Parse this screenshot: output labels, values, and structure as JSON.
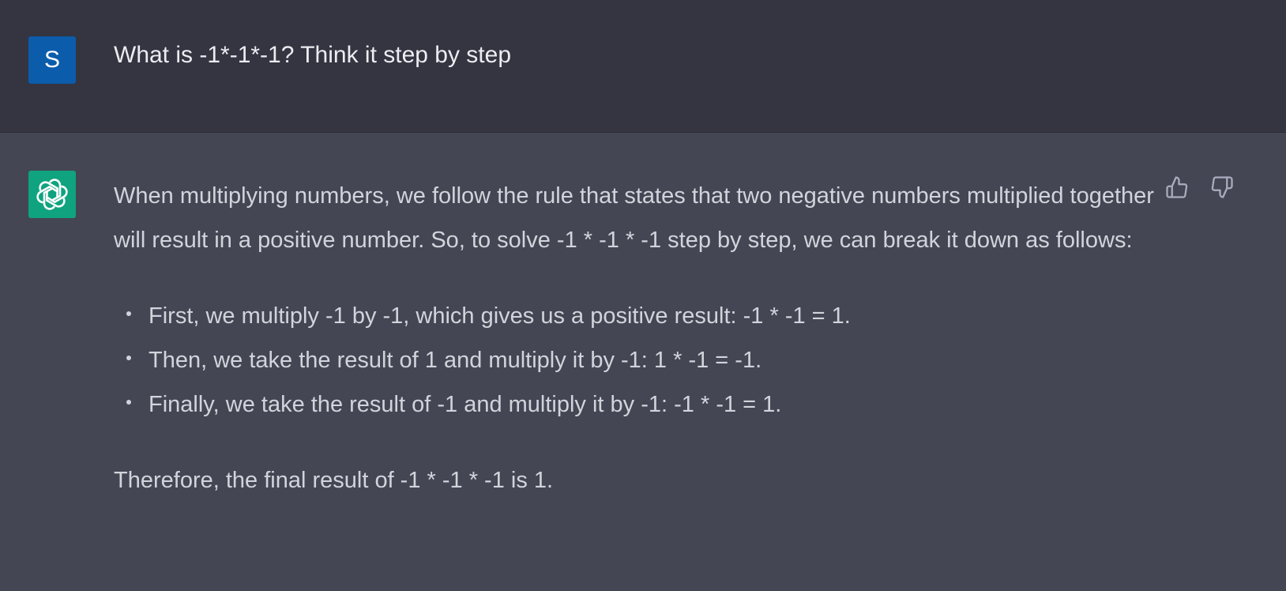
{
  "user_message": {
    "avatar_letter": "S",
    "avatar_color": "#0b5cab",
    "text": "What is -1*-1*-1? Think it step by step"
  },
  "assistant_message": {
    "avatar_icon": "openai-logo-icon",
    "avatar_color": "#10a37f",
    "intro": "When multiplying numbers, we follow the rule that states that two negative numbers multiplied together will result in a positive number. So, to solve -1 * -1 * -1 step by step, we can break it down as follows:",
    "steps": [
      "First, we multiply -1 by -1, which gives us a positive result: -1 * -1 = 1.",
      "Then, we take the result of 1 and multiply it by -1: 1 * -1 = -1.",
      "Finally, we take the result of -1 and multiply it by -1: -1 * -1 = 1."
    ],
    "conclusion": "Therefore, the final result of -1 * -1 * -1 is 1."
  },
  "feedback_icons": [
    "thumbs-up-icon",
    "thumbs-down-icon"
  ],
  "colors": {
    "user_row_bg": "#343541",
    "assistant_row_bg": "#444654",
    "text_primary": "#ececf1",
    "text_secondary": "#d1d5db"
  }
}
